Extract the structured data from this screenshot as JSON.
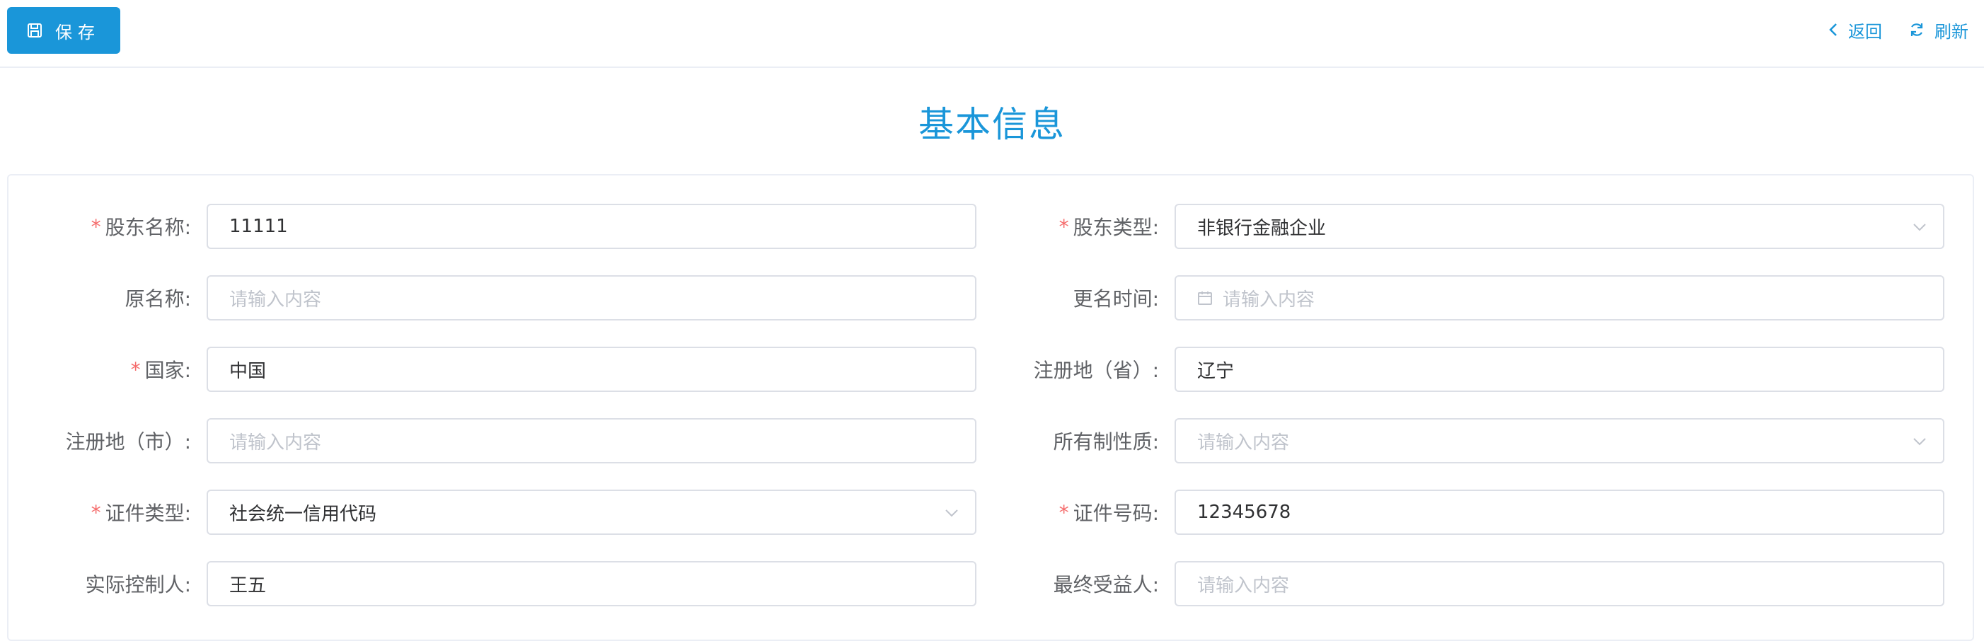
{
  "toolbar": {
    "save_label": "保存",
    "back_label": "返回",
    "refresh_label": "刷新"
  },
  "section_title": "基本信息",
  "form": {
    "shareholder_name": {
      "label": "股东名称:",
      "required": true,
      "value": "11111"
    },
    "shareholder_type": {
      "label": "股东类型:",
      "required": true,
      "value": "非银行金融企业"
    },
    "former_name": {
      "label": "原名称:",
      "required": false,
      "placeholder": "请输入内容"
    },
    "rename_time": {
      "label": "更名时间:",
      "required": false,
      "placeholder": "请输入内容"
    },
    "country": {
      "label": "国家:",
      "required": true,
      "value": "中国"
    },
    "reg_province": {
      "label": "注册地（省）:",
      "required": false,
      "value": "辽宁"
    },
    "reg_city": {
      "label": "注册地（市）:",
      "required": false,
      "placeholder": "请输入内容"
    },
    "ownership_nature": {
      "label": "所有制性质:",
      "required": false,
      "placeholder": "请输入内容"
    },
    "cert_type": {
      "label": "证件类型:",
      "required": true,
      "value": "社会统一信用代码"
    },
    "cert_number": {
      "label": "证件号码:",
      "required": true,
      "value": "12345678"
    },
    "actual_controller": {
      "label": "实际控制人:",
      "required": false,
      "value": "王五"
    },
    "ultimate_beneficiary": {
      "label": "最终受益人:",
      "required": false,
      "placeholder": "请输入内容"
    }
  },
  "required_mark": "*",
  "colors": {
    "accent": "#1a96d9",
    "required": "#f56c6c",
    "border": "#dcdfe6",
    "placeholder": "#c0c4cc"
  },
  "icons": [
    "save-icon",
    "chevron-left-icon",
    "refresh-icon",
    "chevron-down-icon",
    "calendar-icon"
  ]
}
